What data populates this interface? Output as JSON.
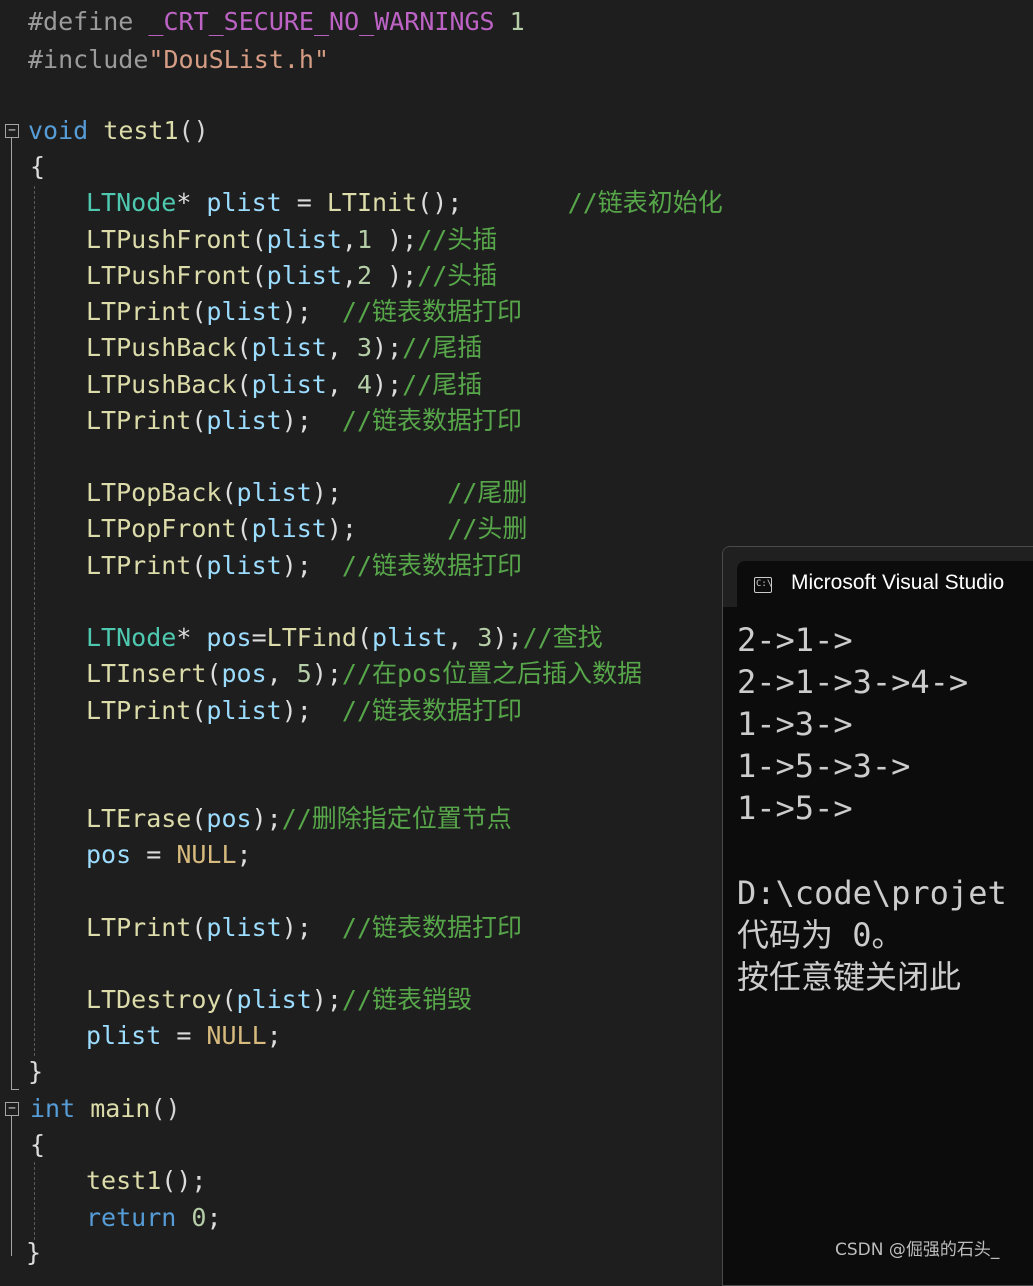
{
  "editor": {
    "l1": {
      "a": "#define ",
      "b": "_CRT_SECURE_NO_WARNINGS",
      "c": " 1"
    },
    "l2": {
      "a": "#include",
      "b": "\"DouSList.h\""
    },
    "l4": {
      "a": "void",
      "b": " ",
      "c": "test1",
      "d": "()"
    },
    "l5": "{",
    "l6": {
      "a": "LTNode",
      "b": "* ",
      "c": "plist",
      "d": " = ",
      "e": "LTInit",
      "f": "();       ",
      "g": "//链表初始化"
    },
    "l7": {
      "a": "LTPushFront",
      "b": "(",
      "c": "plist",
      "d": ",",
      "e": "1",
      "f": " );",
      "g": "//头插"
    },
    "l8": {
      "a": "LTPushFront",
      "b": "(",
      "c": "plist",
      "d": ",",
      "e": "2",
      "f": " );",
      "g": "//头插"
    },
    "l9": {
      "a": "LTPrint",
      "b": "(",
      "c": "plist",
      "d": ");  ",
      "e": "//链表数据打印"
    },
    "l10": {
      "a": "LTPushBack",
      "b": "(",
      "c": "plist",
      "d": ", ",
      "e": "3",
      "f": ");",
      "g": "//尾插"
    },
    "l11": {
      "a": "LTPushBack",
      "b": "(",
      "c": "plist",
      "d": ", ",
      "e": "4",
      "f": ");",
      "g": "//尾插"
    },
    "l12": {
      "a": "LTPrint",
      "b": "(",
      "c": "plist",
      "d": ");  ",
      "e": "//链表数据打印"
    },
    "l14": {
      "a": "LTPopBack",
      "b": "(",
      "c": "plist",
      "d": ");       ",
      "e": "//尾删"
    },
    "l15": {
      "a": "LTPopFront",
      "b": "(",
      "c": "plist",
      "d": ");      ",
      "e": "//头删"
    },
    "l16": {
      "a": "LTPrint",
      "b": "(",
      "c": "plist",
      "d": ");  ",
      "e": "//链表数据打印"
    },
    "l18": {
      "a": "LTNode",
      "b": "* ",
      "c": "pos",
      "d": "=",
      "e": "LTFind",
      "f": "(",
      "g": "plist",
      "h": ", ",
      "i": "3",
      "j": ");",
      "k": "//查找"
    },
    "l19": {
      "a": "LTInsert",
      "b": "(",
      "c": "pos",
      "d": ", ",
      "e": "5",
      "f": ");",
      "g": "//在pos位置之后插入数据"
    },
    "l20": {
      "a": "LTPrint",
      "b": "(",
      "c": "plist",
      "d": ");  ",
      "e": "//链表数据打印"
    },
    "l23": {
      "a": "LTErase",
      "b": "(",
      "c": "pos",
      "d": ");",
      "e": "//删除指定位置节点"
    },
    "l24": {
      "a": "pos",
      "b": " = ",
      "c": "NULL",
      "d": ";"
    },
    "l26": {
      "a": "LTPrint",
      "b": "(",
      "c": "plist",
      "d": ");  ",
      "e": "//链表数据打印"
    },
    "l28": {
      "a": "LTDestroy",
      "b": "(",
      "c": "plist",
      "d": ");",
      "e": "//链表销毁"
    },
    "l29": {
      "a": "plist",
      "b": " = ",
      "c": "NULL",
      "d": ";"
    },
    "l30": "}",
    "l31": {
      "a": "int",
      "b": " ",
      "c": "main",
      "d": "()"
    },
    "l32": "{",
    "l33": {
      "a": "test1",
      "b": "();"
    },
    "l34": {
      "a": "return",
      "b": " ",
      "c": "0",
      "d": ";"
    },
    "l35": "}"
  },
  "console": {
    "title": "Microsoft Visual Studio",
    "icon": "terminal-icon",
    "icon_text": "C:\\",
    "lines": [
      "2->1->",
      "2->1->3->4->",
      "1->3->",
      "1->5->3->",
      "1->5->",
      "",
      "D:\\code\\projet",
      "代码为 0。",
      "按任意键关闭此"
    ]
  },
  "watermark": "CSDN @倔强的石头_"
}
